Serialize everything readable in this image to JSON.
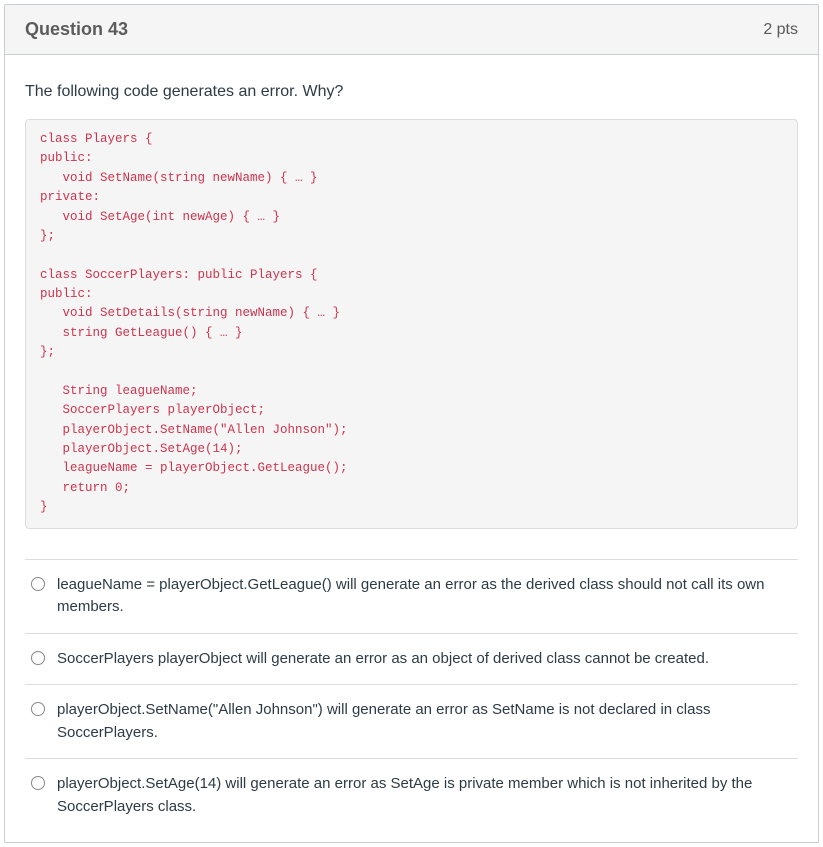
{
  "header": {
    "title": "Question 43",
    "points": "2 pts"
  },
  "prompt": "The following code generates an error. Why?",
  "code": "class Players {\npublic:\n   void SetName(string newName) { … }\nprivate:\n   void SetAge(int newAge) { … }\n};\n\nclass SoccerPlayers: public Players {\npublic:\n   void SetDetails(string newName) { … }\n   string GetLeague() { … }\n};\n\n   String leagueName;\n   SoccerPlayers playerObject;\n   playerObject.SetName(\"Allen Johnson\");\n   playerObject.SetAge(14);\n   leagueName = playerObject.GetLeague();\n   return 0;\n}",
  "options": [
    {
      "text": "leagueName = playerObject.GetLeague() will generate an error as the derived class should not call its own members."
    },
    {
      "text": "SoccerPlayers playerObject will generate an error as an object of derived class cannot be created."
    },
    {
      "text": "playerObject.SetName(\"Allen Johnson\") will generate an error as SetName is not declared in class SoccerPlayers."
    },
    {
      "text": "playerObject.SetAge(14) will generate an error as SetAge is private member which is not inherited by the SoccerPlayers class."
    }
  ]
}
